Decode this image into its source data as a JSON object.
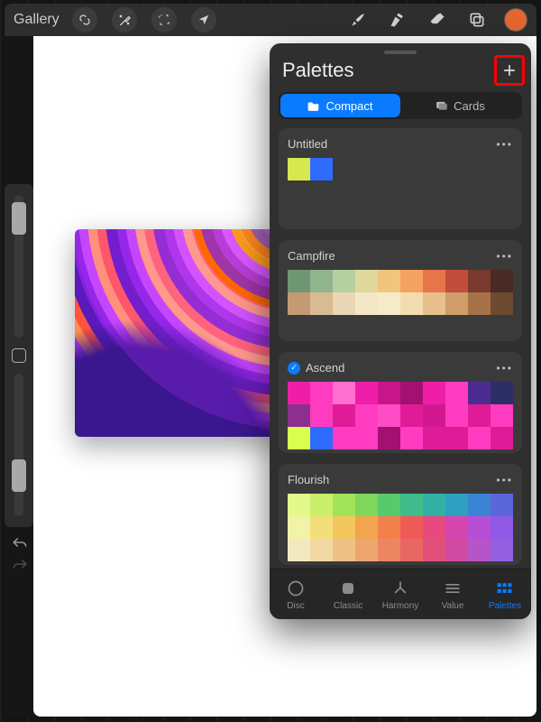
{
  "toolbar": {
    "gallery_label": "Gallery",
    "current_color": "#e2662e"
  },
  "panel": {
    "title": "Palettes",
    "segmented": {
      "compact": "Compact",
      "cards": "Cards",
      "active": "compact"
    },
    "footer": {
      "disc": "Disc",
      "classic": "Classic",
      "harmony": "Harmony",
      "value": "Value",
      "palettes": "Palettes",
      "active": "palettes"
    }
  },
  "palettes": [
    {
      "name": "Untitled",
      "default": false,
      "rows": [
        [
          "#d6e84e",
          "#2e6bff",
          "",
          "",
          "",
          "",
          "",
          "",
          "",
          ""
        ],
        [
          "",
          "",
          "",
          "",
          "",
          "",
          "",
          "",
          "",
          ""
        ],
        [
          "",
          "",
          "",
          "",
          "",
          "",
          "",
          "",
          "",
          ""
        ]
      ]
    },
    {
      "name": "Campfire",
      "default": false,
      "rows": [
        [
          "#6f9673",
          "#8fb58d",
          "#b6cfa1",
          "#e0d79a",
          "#efc67b",
          "#f3a25f",
          "#e8744a",
          "#c14d3d",
          "#7a3a2f",
          "#4a2a25"
        ],
        [
          "#c39a74",
          "#d8bb92",
          "#e9d7b5",
          "#f3e7c7",
          "#f6eacb",
          "#f3ddb0",
          "#e7c08c",
          "#d19d69",
          "#a87249",
          "#6d4a30"
        ],
        [
          "",
          "",
          "",
          "",
          "",
          "",
          "",
          "",
          "",
          ""
        ]
      ]
    },
    {
      "name": "Ascend",
      "default": true,
      "rows": [
        [
          "#ef1ea9",
          "#ff3cc0",
          "#ff6fce",
          "#ef1ea9",
          "#c71687",
          "#a21170",
          "#ef1ea9",
          "#ff3cc0",
          "#4b2d8f",
          "#2e2e67"
        ],
        [
          "#8c2f8f",
          "#ff3cc0",
          "#e01b98",
          "#ff3cc0",
          "#ff4cc6",
          "#e01b98",
          "#d11890",
          "#ff3cc0",
          "#e01b98",
          "#ff3cc0"
        ],
        [
          "#d8ff4e",
          "#2e6bff",
          "#ff3cc0",
          "#ff3cc0",
          "#a21170",
          "#ff3cc0",
          "#e01b98",
          "#e01b98",
          "#ff3cc0",
          "#e01b98"
        ]
      ]
    },
    {
      "name": "Flourish",
      "default": false,
      "rows": [
        [
          "#e3f98a",
          "#c9f06b",
          "#a3e35a",
          "#7fd65a",
          "#58c96c",
          "#3ebc89",
          "#33b0a6",
          "#2f9fc0",
          "#3a84d4",
          "#5a66d9"
        ],
        [
          "#f0f3a8",
          "#f2df7a",
          "#f3c65e",
          "#f3a44e",
          "#f2804a",
          "#ee5a56",
          "#e84a80",
          "#d646b1",
          "#b84ed6",
          "#9059e6"
        ],
        [
          "#f3e9c0",
          "#f2d8a3",
          "#f0c186",
          "#eea66f",
          "#ec8662",
          "#e96762",
          "#e14f7b",
          "#d14aa1",
          "#b654c9",
          "#9260e0"
        ]
      ]
    }
  ]
}
